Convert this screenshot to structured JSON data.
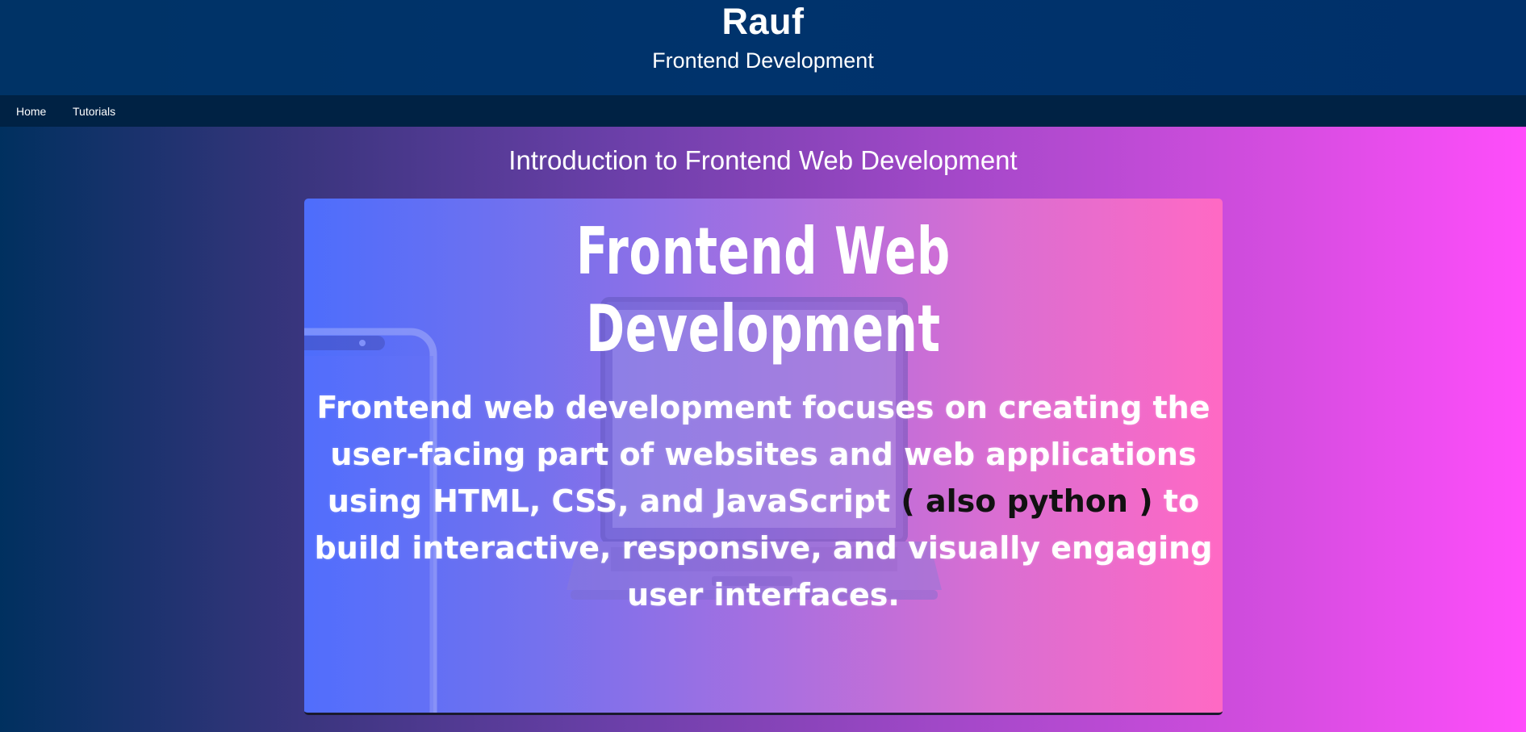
{
  "header": {
    "title": "Rauf",
    "subtitle": "Frontend Development"
  },
  "nav": {
    "items": [
      {
        "label": "Home"
      },
      {
        "label": "Tutorials"
      }
    ]
  },
  "main": {
    "heading": "Introduction to Frontend Web Development",
    "hero": {
      "title": "Frontend Web Development",
      "text_before": "Frontend web development focuses on creating the user-facing part of websites and web applications using HTML, CSS, and JavaScript ",
      "text_highlight": " ( also python )",
      "text_after": " to build interactive, responsive, and visually engaging user interfaces."
    }
  },
  "colors": {
    "header_bg": "#003366",
    "nav_bg": "#002244",
    "text": "#ffffff",
    "highlight_text": "#111111"
  },
  "icons": {
    "phone": "phone-illustration",
    "laptop": "laptop-illustration"
  }
}
